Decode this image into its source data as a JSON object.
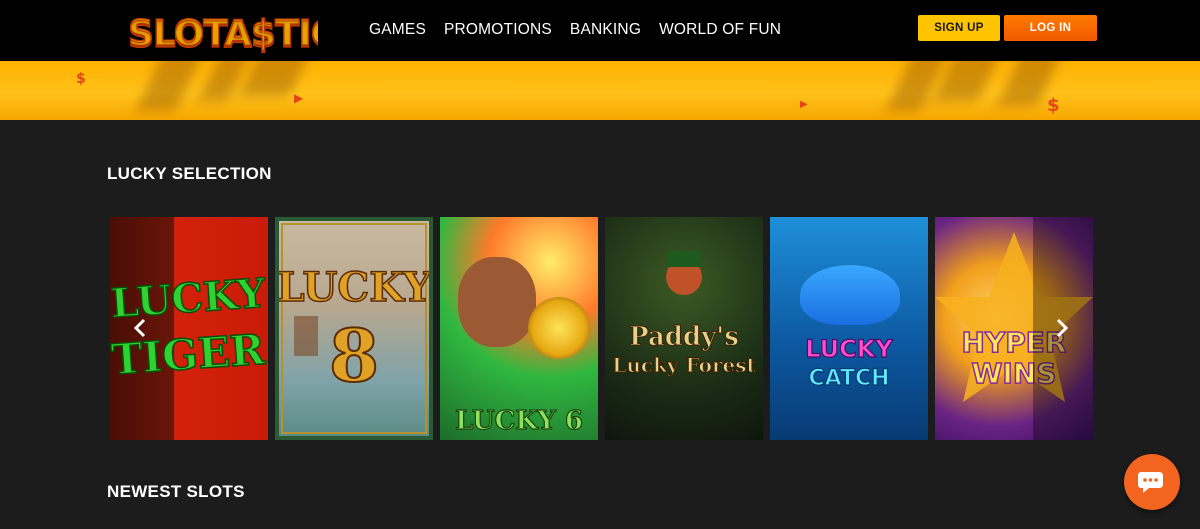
{
  "header": {
    "logo": "SLOTA$TIC",
    "nav": [
      "GAMES",
      "PROMOTIONS",
      "BANKING",
      "WORLD OF FUN"
    ],
    "signup_label": "SIGN UP",
    "login_label": "LOG IN"
  },
  "colors": {
    "accent_yellow": "#ffc400",
    "accent_orange": "#f3641f",
    "background": "#1c1c1c"
  },
  "sections": {
    "lucky_selection_title": "LUCKY SELECTION",
    "newest_slots_title": "NEWEST SLOTS"
  },
  "games": [
    {
      "title": "LUCKY TIGER"
    },
    {
      "title": "LUCKY 8"
    },
    {
      "title": "LUCKY 6"
    },
    {
      "title": "Paddy's Lucky Forest"
    },
    {
      "title": "LUCKY CATCH"
    },
    {
      "title": "HYPER WINS"
    }
  ],
  "icons": {
    "prev": "chevron-left-icon",
    "next": "chevron-right-icon",
    "chat": "chat-bubble-icon"
  }
}
